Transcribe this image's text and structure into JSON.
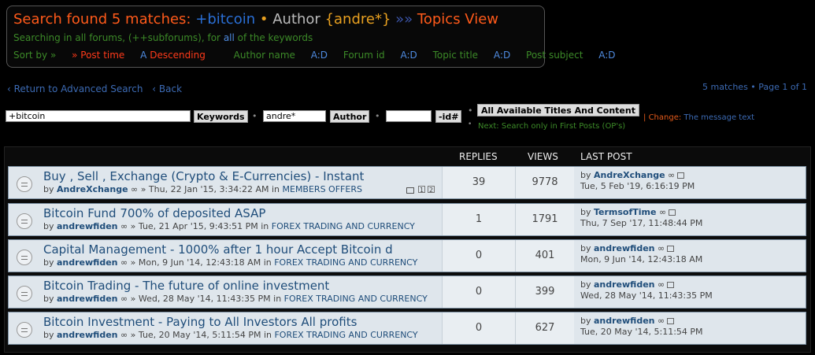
{
  "header": {
    "prefix": "Search found 5 matches:",
    "keyword": "+bitcoin",
    "bullet": "•",
    "author_label": "Author",
    "author_value": "{andre*}",
    "arrows": "»»",
    "view": "Topics View",
    "line2_pre": "Searching in all forums, (++subforums), for ",
    "line2_all": "all",
    "line2_post": " of the keywords"
  },
  "sort": {
    "label": "Sort by »",
    "post_time": "» Post time",
    "post_time_ad": "A",
    "descending": "Descending",
    "author": "Author name",
    "forum": "Forum id",
    "topic": "Topic title",
    "subject": "Post subject",
    "ad": "A:D"
  },
  "nav": {
    "return": "‹ Return to Advanced Search",
    "back": "‹ Back",
    "pageinfo": "5 matches • Page 1 of 1"
  },
  "search": {
    "keywords_value": "+bitcoin",
    "keywords_btn": "Keywords",
    "author_value": "andre*",
    "author_btn": "Author",
    "id_value": "",
    "id_btn": "-id#",
    "all_btn": "All Available Titles And Content",
    "next": "Next: Search only in First Posts (OP's)",
    "change_label": "Change:",
    "change_value": "The message text"
  },
  "columns": {
    "replies": "REPLIES",
    "views": "VIEWS",
    "last_post": "LAST POST"
  },
  "topics": [
    {
      "title": "Buy , Sell , Exchange (Crypto & E-Currencies) - Instant",
      "by": "by",
      "author": "AndreXchange",
      "inf": "∞",
      "date": "» Thu, 22 Jan '15, 3:34:22 AM in",
      "forum": "MEMBERS OFFERS",
      "replies": "39",
      "views": "9778",
      "lp_by": "by",
      "lp_author": "AndreXchange",
      "lp_inf": "∞",
      "lp_date": "Tue, 5 Feb '19, 6:16:19 PM",
      "pages": [
        "1",
        "2"
      ]
    },
    {
      "title": "Bitcoin Fund 700% of deposited ASAP",
      "by": "by",
      "author": "andrewfiden",
      "inf": "∞",
      "date": "» Tue, 21 Apr '15, 9:43:51 PM in",
      "forum": "FOREX TRADING AND CURRENCY",
      "replies": "1",
      "views": "1791",
      "lp_by": "by",
      "lp_author": "TermsofTime",
      "lp_inf": "∞",
      "lp_date": "Thu, 7 Sep '17, 11:48:44 PM"
    },
    {
      "title": "Capital Management - 1000% after 1 hour Accept Bitcoin d",
      "by": "by",
      "author": "andrewfiden",
      "inf": "∞",
      "date": "» Mon, 9 Jun '14, 12:43:18 AM in",
      "forum": "FOREX TRADING AND CURRENCY",
      "replies": "0",
      "views": "401",
      "lp_by": "by",
      "lp_author": "andrewfiden",
      "lp_inf": "∞",
      "lp_date": "Mon, 9 Jun '14, 12:43:18 AM"
    },
    {
      "title": "Bitcoin Trading - The future of online investment",
      "by": "by",
      "author": "andrewfiden",
      "inf": "∞",
      "date": "» Wed, 28 May '14, 11:43:35 PM in",
      "forum": "FOREX TRADING AND CURRENCY",
      "replies": "0",
      "views": "399",
      "lp_by": "by",
      "lp_author": "andrewfiden",
      "lp_inf": "∞",
      "lp_date": "Wed, 28 May '14, 11:43:35 PM"
    },
    {
      "title": "Bitcoin Investment - Paying to All Investors All profits",
      "by": "by",
      "author": "andrewfiden",
      "inf": "∞",
      "date": "» Tue, 20 May '14, 5:11:54 PM in",
      "forum": "FOREX TRADING AND CURRENCY",
      "replies": "0",
      "views": "627",
      "lp_by": "by",
      "lp_author": "andrewfiden",
      "lp_inf": "∞",
      "lp_date": "Tue, 20 May '14, 5:11:54 PM"
    }
  ]
}
